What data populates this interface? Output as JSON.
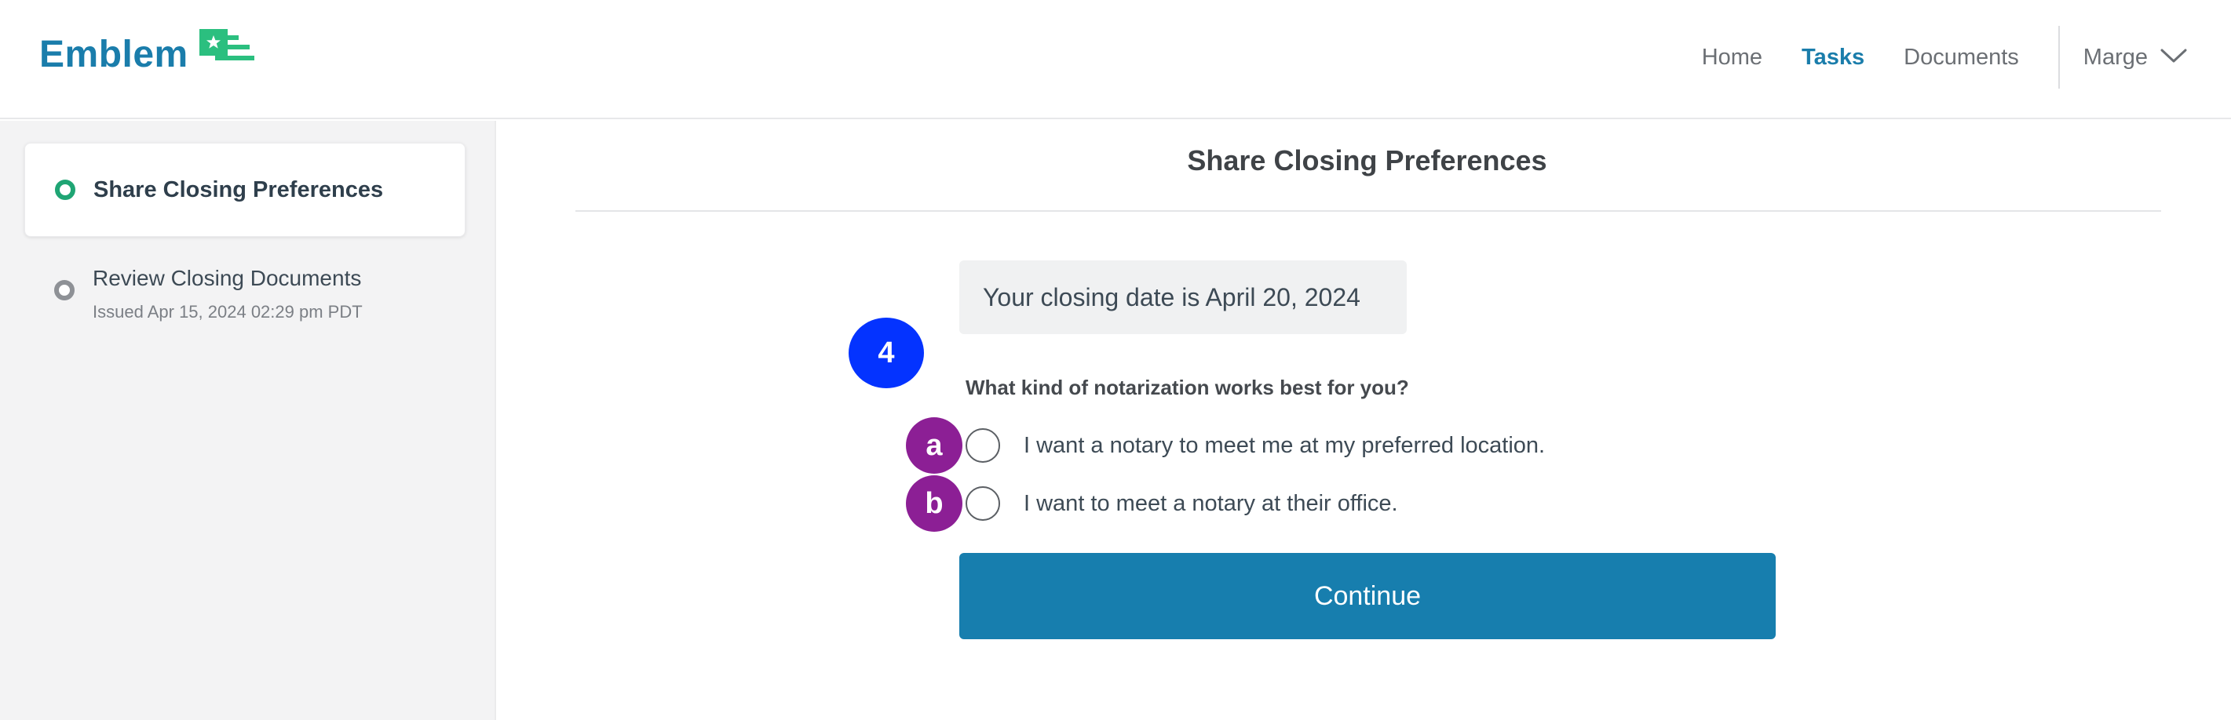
{
  "header": {
    "logo_text": "Emblem",
    "nav": [
      {
        "label": "Home"
      },
      {
        "label": "Tasks"
      },
      {
        "label": "Documents"
      }
    ],
    "user": {
      "name": "Marge"
    }
  },
  "sidebar": {
    "tasks": [
      {
        "title": "Share Closing Preferences",
        "subtitle": "",
        "status": "active"
      },
      {
        "title": "Review Closing Documents",
        "subtitle": "Issued Apr 15, 2024 02:29 pm PDT",
        "status": "pending"
      }
    ]
  },
  "main": {
    "title": "Share Closing Preferences",
    "closing_date_text": "Your closing date is April 20, 2024",
    "step_badge": "4",
    "question": "What kind of notarization works best for you?",
    "options": [
      {
        "badge": "a",
        "label": "I want a notary to meet me at my preferred location.",
        "selected": false
      },
      {
        "badge": "b",
        "label": "I want to meet a notary at their office.",
        "selected": false
      }
    ],
    "continue_label": "Continue"
  },
  "colors": {
    "brand_blue": "#1a7dab",
    "brand_green": "#2bbf7f",
    "button_blue": "#177eae",
    "step_badge": "#0433ff",
    "option_badge": "#8c1f95",
    "active_dot": "#1fa574"
  }
}
